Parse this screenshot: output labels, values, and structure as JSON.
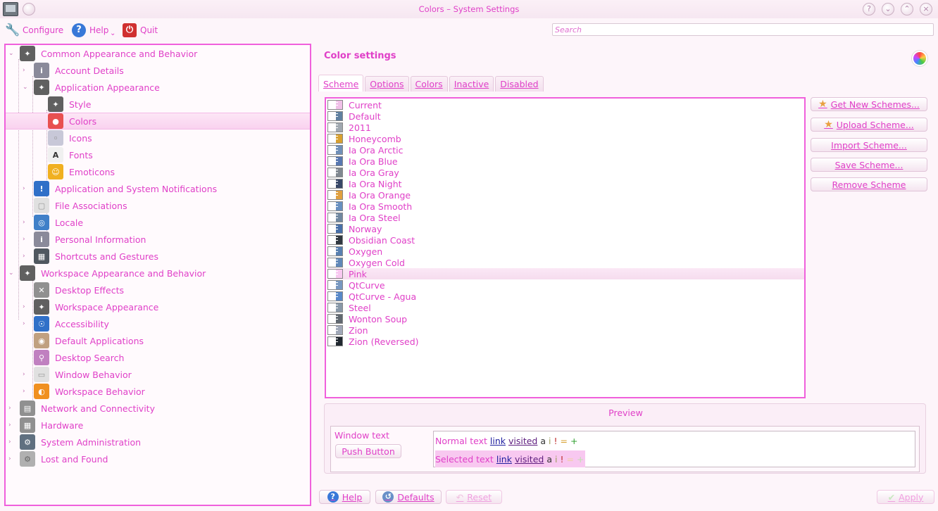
{
  "window": {
    "title": "Colors – System Settings"
  },
  "toolbar": {
    "configure": "Configure",
    "help": "Help",
    "quit": "Quit"
  },
  "search": {
    "placeholder": "Search"
  },
  "tree": {
    "items": [
      "Common Appearance and Behavior",
      "Account Details",
      "Application Appearance",
      "Style",
      "Colors",
      "Icons",
      "Fonts",
      "Emoticons",
      "Application and System Notifications",
      "File Associations",
      "Locale",
      "Personal Information",
      "Shortcuts and Gestures",
      "Workspace Appearance and Behavior",
      "Desktop Effects",
      "Workspace Appearance",
      "Accessibility",
      "Default Applications",
      "Desktop Search",
      "Window Behavior",
      "Workspace Behavior",
      "Network and Connectivity",
      "Hardware",
      "System Administration",
      "Lost and Found"
    ],
    "selected": "Colors"
  },
  "panel": {
    "title": "Color settings"
  },
  "tabs": [
    "Scheme",
    "Options",
    "Colors",
    "Inactive",
    "Disabled"
  ],
  "schemes": {
    "items": [
      {
        "name": "Current",
        "color": "#f0c0e8"
      },
      {
        "name": "Default",
        "color": "#6080a0"
      },
      {
        "name": "2011",
        "color": "#a0a8b0"
      },
      {
        "name": "Honeycomb",
        "color": "#d8a030"
      },
      {
        "name": "Ia Ora Arctic",
        "color": "#7090b8"
      },
      {
        "name": "Ia Ora Blue",
        "color": "#5878b0"
      },
      {
        "name": "Ia Ora Gray",
        "color": "#808890"
      },
      {
        "name": "Ia Ora Night",
        "color": "#384868"
      },
      {
        "name": "Ia Ora Orange",
        "color": "#e0a040"
      },
      {
        "name": "Ia Ora Smooth",
        "color": "#6890c0"
      },
      {
        "name": "Ia Ora Steel",
        "color": "#7088a0"
      },
      {
        "name": "Norway",
        "color": "#4870a8"
      },
      {
        "name": "Obsidian Coast",
        "color": "#303840"
      },
      {
        "name": "Oxygen",
        "color": "#5880b0"
      },
      {
        "name": "Oxygen Cold",
        "color": "#6088b8"
      },
      {
        "name": "Pink",
        "color": "#f8c8f0"
      },
      {
        "name": "QtCurve",
        "color": "#7898c0"
      },
      {
        "name": "QtCurve - Agua",
        "color": "#5888c8"
      },
      {
        "name": "Steel",
        "color": "#8898a8"
      },
      {
        "name": "Wonton Soup",
        "color": "#606870"
      },
      {
        "name": "Zion",
        "color": "#a0a8b8"
      },
      {
        "name": "Zion (Reversed)",
        "color": "#202830"
      }
    ],
    "selected": "Pink"
  },
  "actions": {
    "get_new": "Get New Schemes...",
    "upload": "Upload Scheme...",
    "import": "Import Scheme...",
    "save": "Save Scheme...",
    "remove": "Remove Scheme"
  },
  "preview": {
    "title": "Preview",
    "window_text": "Window text",
    "push_button": "Push Button",
    "normal_text": "Normal text",
    "selected_text": "Selected text",
    "link": "link",
    "visited": "visited",
    "glyphs": [
      "a",
      "i",
      "!",
      "=",
      "+"
    ]
  },
  "bottom": {
    "help": "Help",
    "defaults": "Defaults",
    "reset": "Reset",
    "apply": "Apply"
  }
}
